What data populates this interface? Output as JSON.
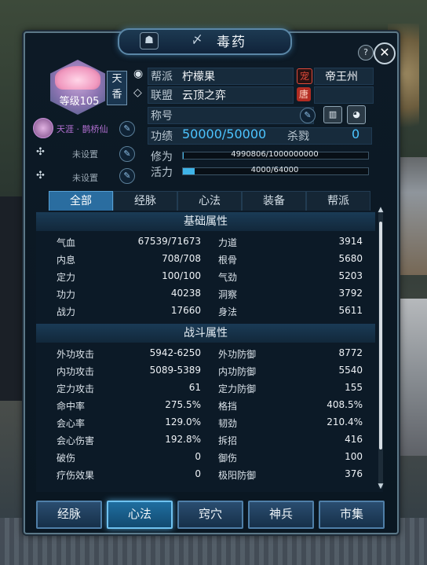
{
  "window": {
    "title": "毒药",
    "help_label": "?",
    "close_label": "✕"
  },
  "profile": {
    "level_text": "等级105",
    "school_line1": "天",
    "school_line2": "香",
    "world_title": "天涯 · 鹊桥仙",
    "unset_1": "未设置",
    "unset_2": "未设置"
  },
  "info": {
    "faction_label": "帮派",
    "faction_value": "柠檬果",
    "faction_tag": "宠",
    "faction_server": "帝王州",
    "alliance_label": "联盟",
    "alliance_value": "云顶之弈",
    "alliance_tag": "唐",
    "title_label": "称号",
    "merit_label": "功绩",
    "merit_value": "50000/50000",
    "kill_label": "杀戮",
    "kill_value": "0",
    "cultivation_label": "修为",
    "cultivation_value": "4990806/1000000000",
    "cultivation_ratio": 0.005,
    "vitality_label": "活力",
    "vitality_value": "4000/64000",
    "vitality_ratio": 0.0625
  },
  "tabs": [
    "全部",
    "经脉",
    "心法",
    "装备",
    "帮派"
  ],
  "sections": {
    "basic": "基础属性",
    "combat": "战斗属性"
  },
  "basic_stats": [
    [
      "气血",
      "67539/71673",
      "力道",
      "3914"
    ],
    [
      "内息",
      "708/708",
      "根骨",
      "5680"
    ],
    [
      "定力",
      "100/100",
      "气劲",
      "5203"
    ],
    [
      "功力",
      "40238",
      "洞察",
      "3792"
    ],
    [
      "战力",
      "17660",
      "身法",
      "5611"
    ]
  ],
  "combat_stats": [
    [
      "外功攻击",
      "5942-6250",
      "外功防御",
      "8772"
    ],
    [
      "内功攻击",
      "5089-5389",
      "内功防御",
      "5540"
    ],
    [
      "定力攻击",
      "61",
      "定力防御",
      "155"
    ],
    [
      "命中率",
      "275.5%",
      "格挡",
      "408.5%"
    ],
    [
      "会心率",
      "129.0%",
      "韧劲",
      "210.4%"
    ],
    [
      "会心伤害",
      "192.8%",
      "拆招",
      "416"
    ],
    [
      "破伤",
      "0",
      "御伤",
      "100"
    ],
    [
      "疗伤效果",
      "0",
      "极阳防御",
      "376"
    ]
  ],
  "bottom_buttons": [
    "经脉",
    "心法",
    "窍穴",
    "神兵",
    "市集"
  ]
}
